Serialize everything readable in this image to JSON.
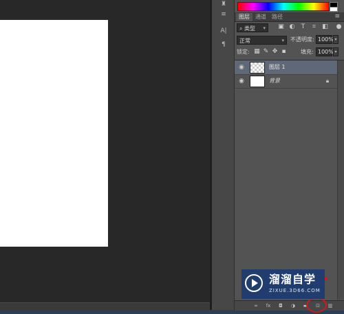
{
  "panel_tabs": {
    "layers": "图层",
    "channels": "通道",
    "paths": "路径"
  },
  "filter": {
    "kind_label": "类型"
  },
  "blend": {
    "mode": "正常",
    "opacity_label": "不透明度:",
    "opacity_value": "100%"
  },
  "lock_row": {
    "label": "锁定:",
    "fill_label": "填充:",
    "fill_value": "100%"
  },
  "layers": [
    {
      "name": "图层 1",
      "selected": true
    },
    {
      "name": "背景",
      "selected": false,
      "locked": true
    }
  ],
  "watermark": {
    "title": "溜溜自学",
    "url": "ZIXUE.3D66.COM"
  },
  "icons": {
    "visibility": "eye-icon",
    "lock": "lock-icon",
    "new_layer": "new-layer-icon",
    "delete": "trash-icon"
  },
  "colors": {
    "canvas_bg": "#282828",
    "panel_bg": "#535353",
    "selected_layer": "#5f6876",
    "highlight_circle": "#d01a1a",
    "watermark_bg": "#1a3a73"
  }
}
